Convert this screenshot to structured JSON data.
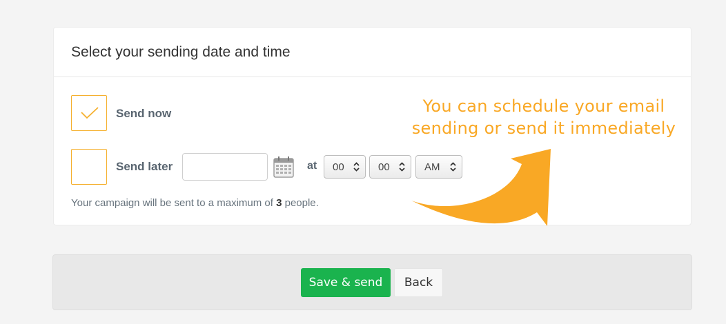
{
  "card": {
    "title": "Select your sending date and time"
  },
  "options": {
    "send_now": {
      "label": "Send now",
      "checked": true
    },
    "send_later": {
      "label": "Send later",
      "checked": false
    }
  },
  "schedule": {
    "date_value": "",
    "at_label": "at",
    "hour": "00",
    "minute": "00",
    "period": "AM"
  },
  "note": {
    "prefix": "Your campaign will be sent to a maximum of",
    "count": "3",
    "suffix": "people."
  },
  "annotation": {
    "line1": "You can schedule your email",
    "line2": "sending or send it immediately"
  },
  "footer": {
    "save_label": "Save & send",
    "back_label": "Back"
  },
  "colors": {
    "accent_orange": "#f5b02e",
    "annotation_orange": "#f9a825",
    "primary_green": "#1ab34e"
  }
}
